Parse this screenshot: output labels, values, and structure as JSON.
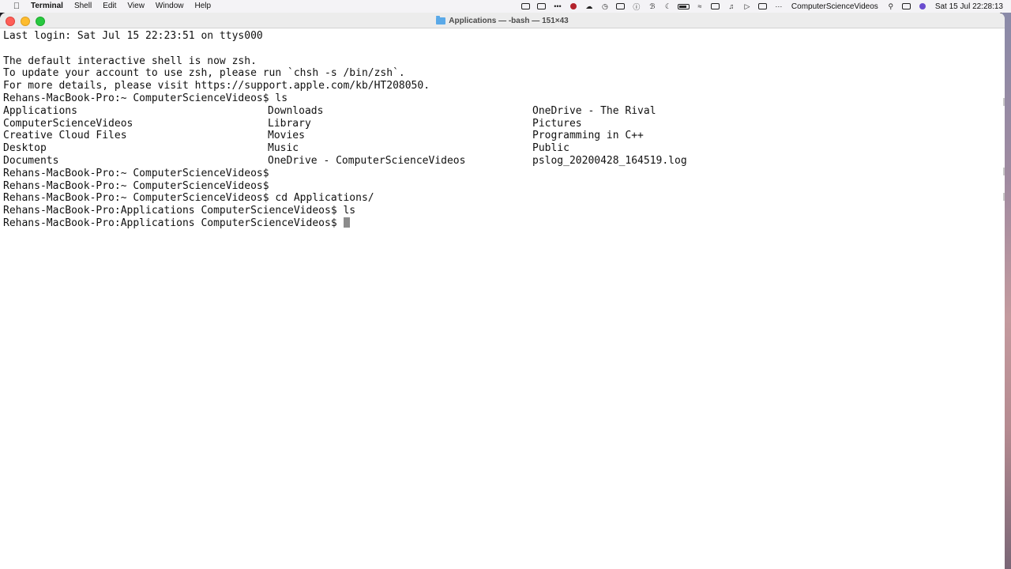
{
  "menubar": {
    "app_name": "Terminal",
    "menus": [
      "Shell",
      "Edit",
      "View",
      "Window",
      "Help"
    ],
    "username": "ComputerScienceVideos",
    "datetime": "Sat 15 Jul  22:28:13"
  },
  "window": {
    "title": "Applications — -bash — 151×43"
  },
  "terminal": {
    "intro_lines": [
      "Last login: Sat Jul 15 22:23:51 on ttys000",
      "",
      "The default interactive shell is now zsh.",
      "To update your account to use zsh, please run `chsh -s /bin/zsh`.",
      "For more details, please visit https://support.apple.com/kb/HT208050.",
      "Rehans-MacBook-Pro:~ ComputerScienceVideos$ ls"
    ],
    "ls_output": [
      [
        "Applications",
        "Downloads",
        "OneDrive - The Rival"
      ],
      [
        "ComputerScienceVideos",
        "Library",
        "Pictures"
      ],
      [
        "Creative Cloud Files",
        "Movies",
        "Programming in C++"
      ],
      [
        "Desktop",
        "Music",
        "Public"
      ],
      [
        "Documents",
        "OneDrive - ComputerScienceVideos",
        "pslog_20200428_164519.log"
      ]
    ],
    "after_lines": [
      "Rehans-MacBook-Pro:~ ComputerScienceVideos$",
      "Rehans-MacBook-Pro:~ ComputerScienceVideos$",
      "Rehans-MacBook-Pro:~ ComputerScienceVideos$ cd Applications/",
      "Rehans-MacBook-Pro:Applications ComputerScienceVideos$ ls"
    ],
    "prompt": "Rehans-MacBook-Pro:Applications ComputerScienceVideos$ "
  }
}
